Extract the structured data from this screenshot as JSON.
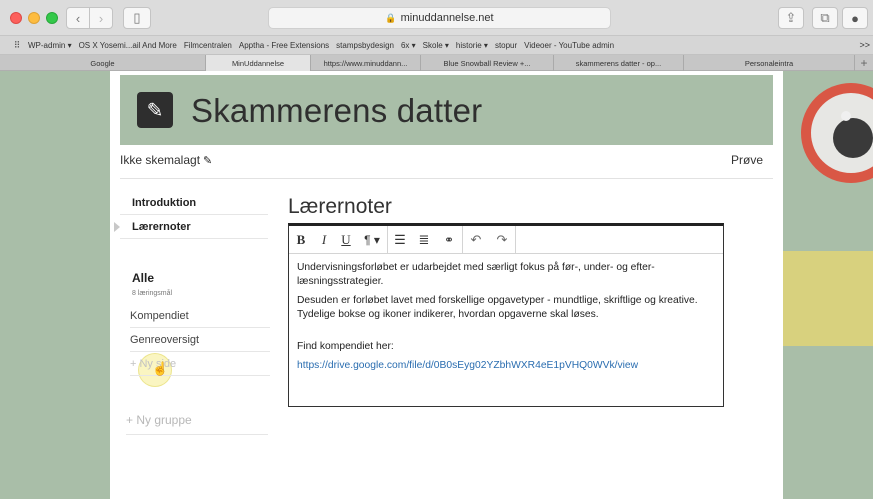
{
  "browser": {
    "url": "minuddannelse.net",
    "bookmarks": [
      "WP-admin ▾",
      "OS X Yosemi...ail And More",
      "Filmcentralen",
      "Apptha - Free Extensions",
      "stampsbydesign",
      "6x ▾",
      "Skole ▾",
      "historie ▾",
      "stopur",
      "Videoer - YouTube admin"
    ],
    "bookmarks_overflow": ">>",
    "tabs": [
      "Google",
      "MinUddannelse",
      "https://www.minuddann...",
      "Blue Snowball Review +...",
      "skammerens datter - op...",
      "Personaleintra"
    ],
    "active_tab_index": 1,
    "new_tab": "+"
  },
  "page": {
    "title": "Skammerens datter",
    "status": "Ikke skemalagt",
    "prove_label": "Prøve",
    "nav": [
      {
        "label": "Introduktion",
        "selected": false
      },
      {
        "label": "Lærernoter",
        "selected": true
      }
    ],
    "group": {
      "title": "Alle",
      "subtitle": "8 læringsmål",
      "items": [
        "Kompendiet",
        "Genreoversigt"
      ],
      "new_page": "+ Ny side"
    },
    "new_group": "+ Ny gruppe",
    "section_title": "Lærernoter",
    "toolbar": {
      "bold": "B",
      "italic": "I",
      "underline": "U",
      "paragraph": "¶ ▾"
    },
    "editor": {
      "paragraph1": "Undervisningsforløbet er udarbejdet med særligt fokus på før-, under- og efter-læsningsstrategier.",
      "paragraph2": "Desuden er forløbet lavet med forskellige opgavetyper - mundtlige, skriftlige og kreative. Tydelige bokse og ikoner indikerer, hvordan opgaverne skal løses.",
      "paragraph3": "Find kompendiet her:",
      "link": "https://drive.google.com/file/d/0B0sEyg02YZbhWXR4eE1pVHQ0WVk/view"
    }
  },
  "colors": {
    "sage": "#a9bea8",
    "yellow": "#d8d17e",
    "pin_red": "#d95745",
    "link": "#2a6db0"
  }
}
